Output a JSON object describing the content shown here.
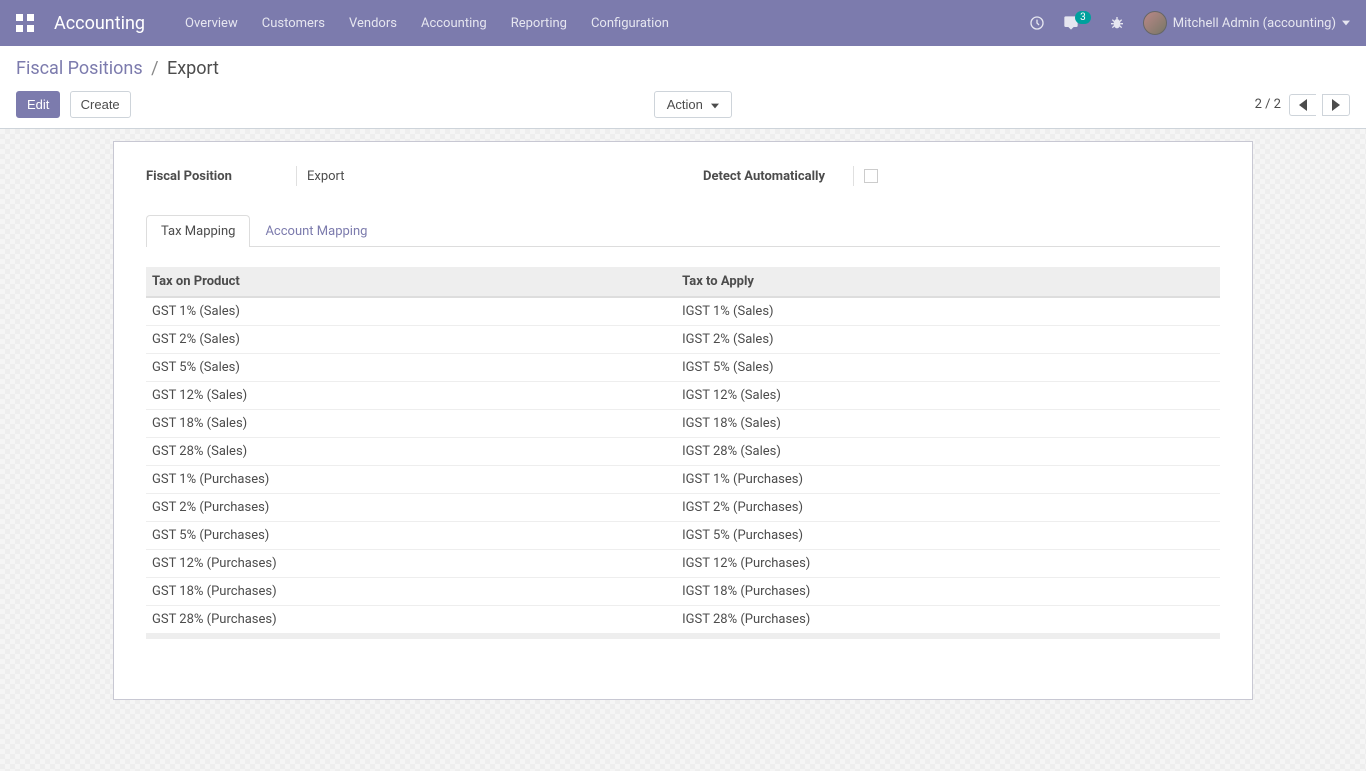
{
  "navbar": {
    "brand": "Accounting",
    "menu": [
      "Overview",
      "Customers",
      "Vendors",
      "Accounting",
      "Reporting",
      "Configuration"
    ],
    "message_badge": "3",
    "user": "Mitchell Admin (accounting)"
  },
  "breadcrumb": {
    "parent": "Fiscal Positions",
    "current": "Export"
  },
  "buttons": {
    "edit": "Edit",
    "create": "Create",
    "action": "Action"
  },
  "pager": {
    "value": "2 / 2"
  },
  "form": {
    "fiscal_position_label": "Fiscal Position",
    "fiscal_position_value": "Export",
    "detect_label": "Detect Automatically"
  },
  "tabs": {
    "tax_mapping": "Tax Mapping",
    "account_mapping": "Account Mapping"
  },
  "table": {
    "col_product": "Tax on Product",
    "col_apply": "Tax to Apply",
    "rows": [
      {
        "product": "GST 1% (Sales)",
        "apply": "IGST 1% (Sales)"
      },
      {
        "product": "GST 2% (Sales)",
        "apply": "IGST 2% (Sales)"
      },
      {
        "product": "GST 5% (Sales)",
        "apply": "IGST 5% (Sales)"
      },
      {
        "product": "GST 12% (Sales)",
        "apply": "IGST 12% (Sales)"
      },
      {
        "product": "GST 18% (Sales)",
        "apply": "IGST 18% (Sales)"
      },
      {
        "product": "GST 28% (Sales)",
        "apply": "IGST 28% (Sales)"
      },
      {
        "product": "GST 1% (Purchases)",
        "apply": "IGST 1% (Purchases)"
      },
      {
        "product": "GST 2% (Purchases)",
        "apply": "IGST 2% (Purchases)"
      },
      {
        "product": "GST 5% (Purchases)",
        "apply": "IGST 5% (Purchases)"
      },
      {
        "product": "GST 12% (Purchases)",
        "apply": "IGST 12% (Purchases)"
      },
      {
        "product": "GST 18% (Purchases)",
        "apply": "IGST 18% (Purchases)"
      },
      {
        "product": "GST 28% (Purchases)",
        "apply": "IGST 28% (Purchases)"
      }
    ]
  }
}
